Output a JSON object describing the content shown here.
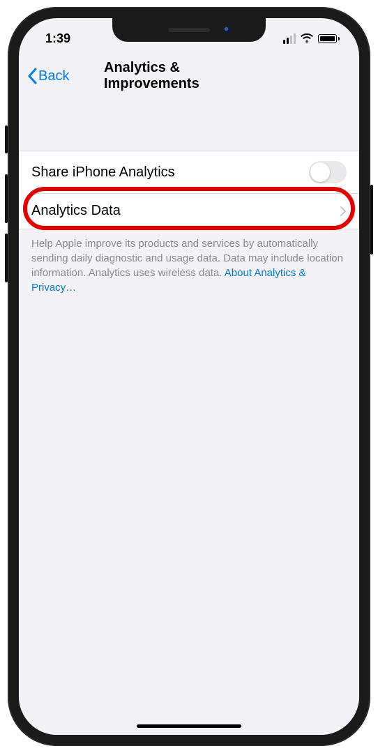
{
  "status": {
    "time": "1:39"
  },
  "nav": {
    "back_label": "Back",
    "title": "Analytics & Improvements"
  },
  "rows": {
    "share": {
      "label": "Share iPhone Analytics"
    },
    "data": {
      "label": "Analytics Data"
    }
  },
  "footer": {
    "text": "Help Apple improve its products and services by automatically sending daily diagnostic and usage data. Data may include location information. Analytics uses wireless data. ",
    "link_label": "About Analytics & Privacy…"
  }
}
